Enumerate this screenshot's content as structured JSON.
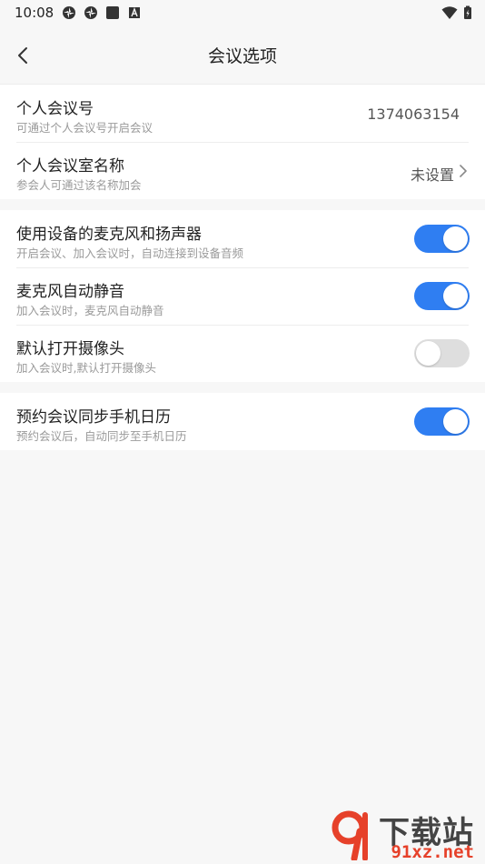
{
  "status_bar": {
    "time": "10:08",
    "left_icons": [
      "app-icon-1",
      "app-icon-2",
      "square-icon",
      "a-badge-icon"
    ],
    "right_icons": [
      "wifi-icon",
      "battery-icon"
    ]
  },
  "nav": {
    "back_icon": "chevron-left-icon",
    "title": "会议选项"
  },
  "meeting_id": {
    "title": "个人会议号",
    "subtitle": "可通过个人会议号开启会议",
    "value": "1374063154"
  },
  "room_name": {
    "title": "个人会议室名称",
    "subtitle": "参会人可通过该名称加会",
    "value": "未设置"
  },
  "settings": [
    {
      "title": "使用设备的麦克风和扬声器",
      "subtitle": "开启会议、加入会议时，自动连接到设备音频",
      "on": true
    },
    {
      "title": "麦克风自动静音",
      "subtitle": "加入会议时，麦克风自动静音",
      "on": true
    },
    {
      "title": "默认打开摄像头",
      "subtitle": "加入会议时,默认打开摄像头",
      "on": false
    }
  ],
  "calendar": {
    "title": "预约会议同步手机日历",
    "subtitle": "预约会议后，自动同步至手机日历",
    "on": true
  },
  "watermark": {
    "cn": "下载站",
    "en": "91xz.net"
  },
  "colors": {
    "toggle_on": "#2f7ef2",
    "toggle_off": "#dedede",
    "background": "#f7f7f7"
  }
}
